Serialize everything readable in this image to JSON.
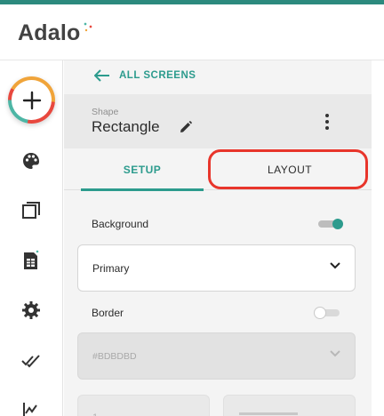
{
  "app": {
    "logo_text": "Adalo"
  },
  "navigation": {
    "back_label": "ALL SCREENS"
  },
  "shape": {
    "kind_label": "Shape",
    "name": "Rectangle"
  },
  "tabs": [
    {
      "label": "SETUP",
      "active": true
    },
    {
      "label": "LAYOUT",
      "active": false,
      "highlighted": true
    }
  ],
  "background": {
    "label": "Background",
    "enabled": true,
    "color_select": {
      "value": "Primary"
    }
  },
  "border": {
    "label": "Border",
    "enabled": false,
    "color_select": {
      "value": "#BDBDBD",
      "disabled": true
    }
  },
  "partial_row": {
    "value": "1"
  },
  "rail_icons": [
    "add-icon",
    "palette-icon",
    "screens-icon",
    "database-icon",
    "settings-icon",
    "publish-icon",
    "analytics-icon"
  ],
  "colors": {
    "accent": "#2c9b8d",
    "top_border": "#2c8a7e",
    "highlight": "#e8352b",
    "panel_bg": "#f4f4f4"
  }
}
